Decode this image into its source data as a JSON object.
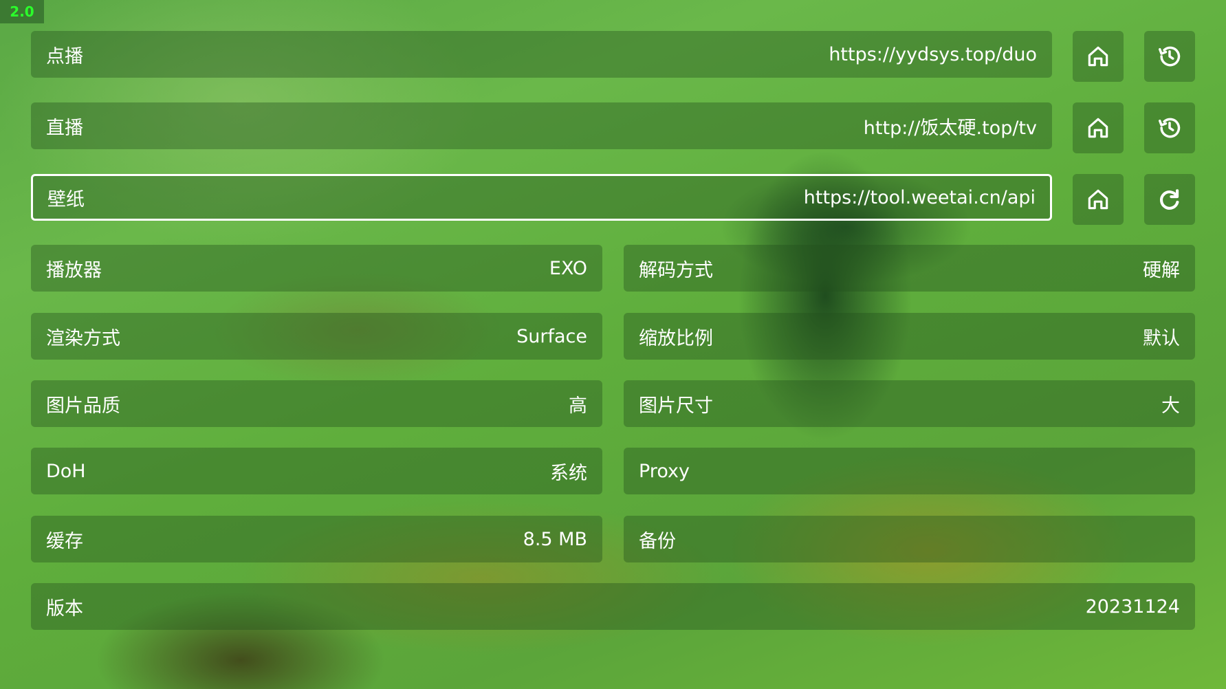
{
  "badge": "2.0",
  "url_rows": [
    {
      "label": "点播",
      "value": "https://yydsys.top/duo",
      "action_icon": "history-icon"
    },
    {
      "label": "直播",
      "value": "http://饭太硬.top/tv",
      "action_icon": "history-icon"
    },
    {
      "label": "壁纸",
      "value": "https://tool.weetai.cn/api",
      "action_icon": "refresh-icon"
    }
  ],
  "settings": {
    "player": {
      "label": "播放器",
      "value": "EXO"
    },
    "decode": {
      "label": "解码方式",
      "value": "硬解"
    },
    "render": {
      "label": "渲染方式",
      "value": "Surface"
    },
    "scale": {
      "label": "缩放比例",
      "value": "默认"
    },
    "image_quality": {
      "label": "图片品质",
      "value": "高"
    },
    "image_size": {
      "label": "图片尺寸",
      "value": "大"
    },
    "doh": {
      "label": "DoH",
      "value": "系统"
    },
    "proxy": {
      "label": "Proxy",
      "value": ""
    },
    "cache": {
      "label": "缓存",
      "value": "8.5 MB"
    },
    "backup": {
      "label": "备份",
      "value": ""
    },
    "version": {
      "label": "版本",
      "value": "20231124"
    }
  },
  "colors": {
    "badge_text": "#2bff2b",
    "panel": "#23501e",
    "selected_border": "#ffffff"
  }
}
